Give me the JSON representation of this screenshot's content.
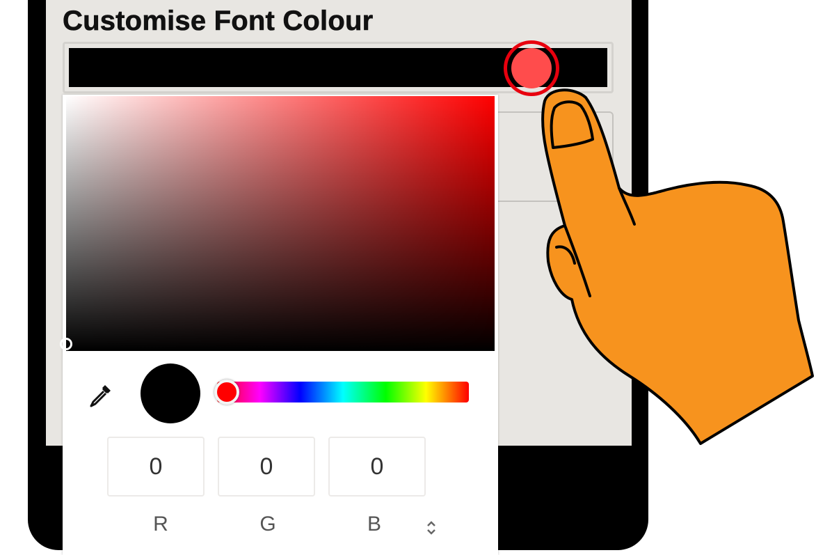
{
  "section": {
    "title": "Customise Font Colour"
  },
  "font_colour": {
    "swatch_hex": "#000000"
  },
  "colour_picker": {
    "hue_hex": "#ff0000",
    "preview_hex": "#000000",
    "channels": [
      {
        "label": "R",
        "value": "0"
      },
      {
        "label": "G",
        "value": "0"
      },
      {
        "label": "B",
        "value": "0"
      }
    ],
    "icons": {
      "eyedropper": "eyedropper-icon",
      "mode_toggle": "up-down-chevrons-icon"
    }
  },
  "annotation": {
    "touch_indicator_hex": "#ff4c4c",
    "touch_ring_hex": "#e8000e",
    "hand_hex": "#f7931e",
    "hand_icon": "pointing-hand-icon"
  }
}
